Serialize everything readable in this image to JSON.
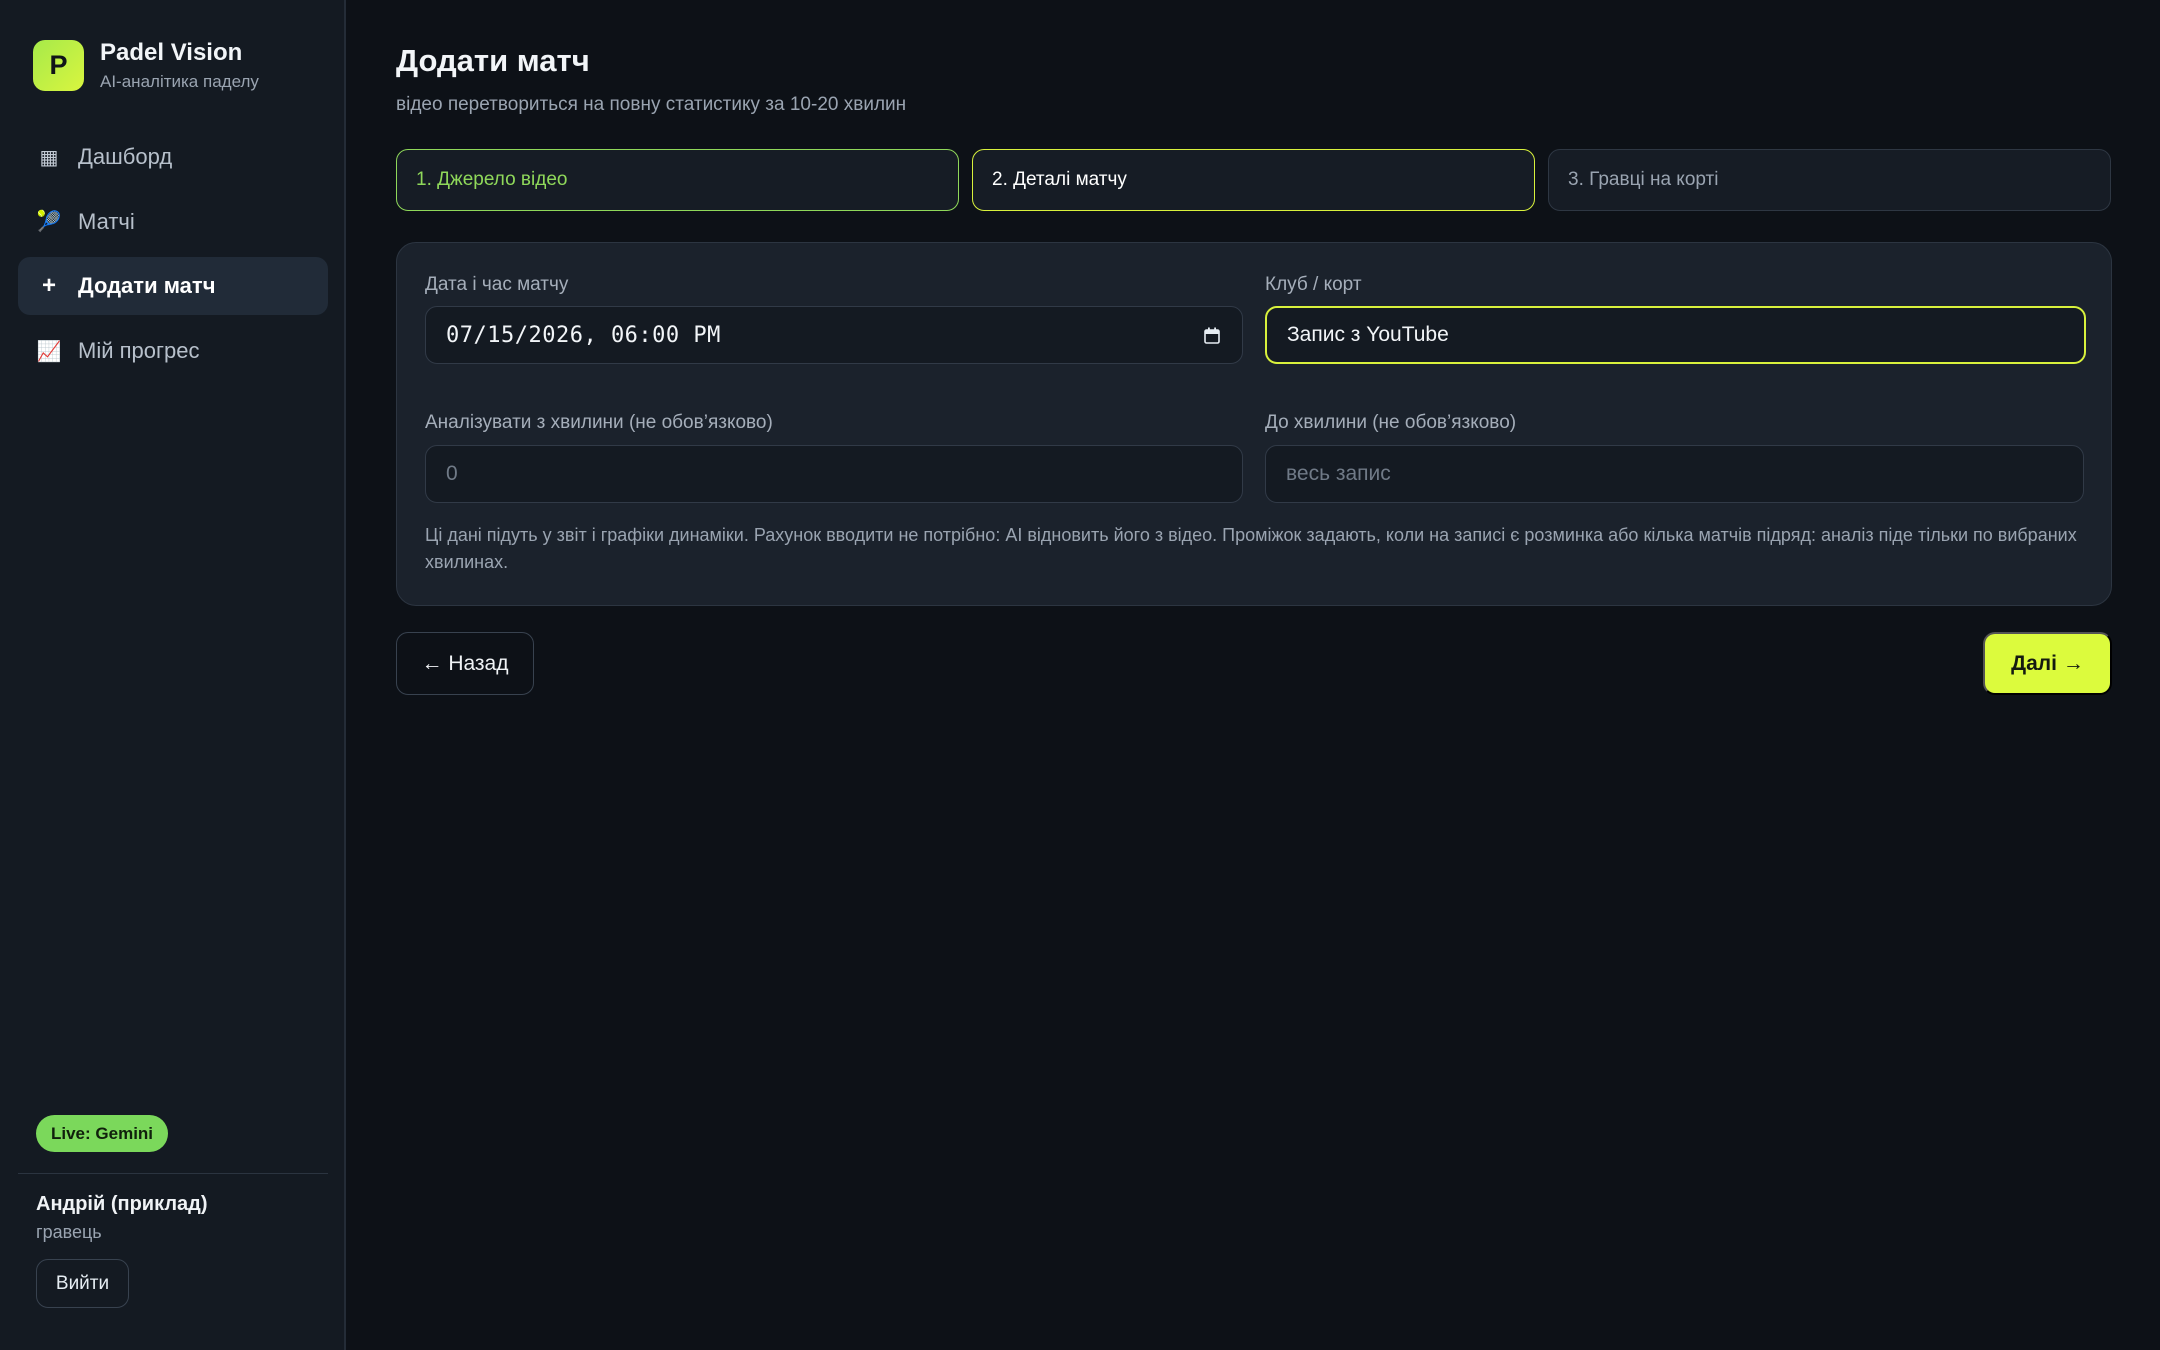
{
  "brand": {
    "logo_letter": "P",
    "name": "Padel Vision",
    "subtitle": "AI-аналітика паделу"
  },
  "nav": {
    "items": [
      {
        "icon": "dashboard-icon",
        "glyph": "▦",
        "label": "Дашборд"
      },
      {
        "icon": "tennis-racket-icon",
        "glyph": "🎾",
        "label": "Матчі"
      },
      {
        "icon": "plus-icon",
        "glyph": "+",
        "label": "Додати матч",
        "active": true
      },
      {
        "icon": "chart-increasing-icon",
        "glyph": "📈",
        "label": "Мій прогрес"
      }
    ]
  },
  "status_badge": "Live: Gemini",
  "user": {
    "name": "Андрій (приклад)",
    "role": "гравець",
    "logout_label": "Вийти"
  },
  "page": {
    "title": "Додати матч",
    "subtitle": "відео перетвориться на повну статистику за 10-20 хвилин"
  },
  "steps": [
    {
      "label": "1. Джерело відео",
      "state": "done"
    },
    {
      "label": "2. Деталі матчу",
      "state": "current"
    },
    {
      "label": "3. Гравці на корті",
      "state": "pending"
    }
  ],
  "form": {
    "datetime": {
      "label": "Дата і час матчу",
      "value": "07/15/2026, 06:00 PM"
    },
    "club": {
      "label": "Клуб / корт",
      "value": "Запис з YouTube"
    },
    "from_minute": {
      "label": "Аналізувати з хвилини (не обов’язково)",
      "placeholder": "0"
    },
    "to_minute": {
      "label": "До хвилини (не обов’язково)",
      "placeholder": "весь запис"
    },
    "note": "Ці дані підуть у звіт і графіки динаміки. Рахунок вводити не потрібно: AI відновить його з відео. Проміжок задають, коли на записі є розминка або кілька матчів підряд: аналіз піде тільки по вибраних хвилинах."
  },
  "actions": {
    "back_label": "← Назад",
    "next_label": "Далі →"
  },
  "colors": {
    "accent": "#dcfb3d",
    "success": "#8fd85a",
    "background": "#0d1117",
    "sidebar": "#141a22",
    "card": "#1b222c"
  }
}
